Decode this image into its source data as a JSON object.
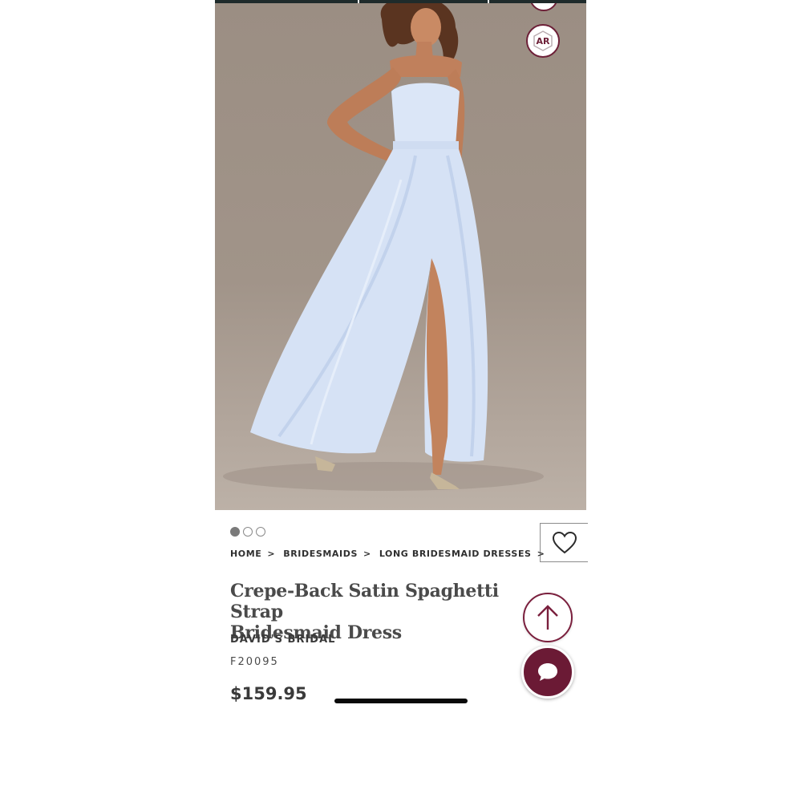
{
  "product": {
    "image_alt": "Model wearing light blue satin spaghetti strap gown",
    "ar_label": "AR",
    "carousel": {
      "total": 3,
      "active": 1
    },
    "breadcrumb": [
      "HOME",
      "BRIDESMAIDS",
      "LONG BRIDESMAID DRESSES"
    ],
    "breadcrumb_separator": ">",
    "title_line1": "Crepe-Back Satin Spaghetti Strap",
    "title_line2": "Bridesmaid Dress",
    "brand": "DAVID'S BRIDAL",
    "sku": "F20095",
    "price": "$159.95"
  },
  "icons": {
    "wishlist": "heart-outline-icon",
    "scroll_top": "arrow-up-icon",
    "chat": "chat-bubble-icon",
    "ar": "ar-hexagon-icon"
  },
  "colors": {
    "brand_accent": "#6b1a35",
    "background_photo": "#a19489",
    "dress": "#d9e4f6"
  }
}
